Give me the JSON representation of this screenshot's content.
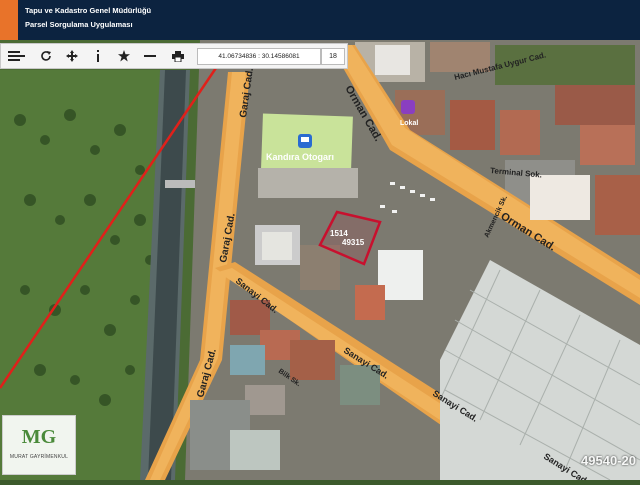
{
  "header": {
    "title_line1": "Tapu ve Kadastro Genel Müdürlüğü",
    "title_line2": "Parsel Sorgulama Uygulaması"
  },
  "toolbar": {
    "buttons": [
      {
        "icon": "menu-icon"
      },
      {
        "icon": "zoom-out-icon"
      },
      {
        "icon": "refresh-icon"
      },
      {
        "icon": "move-icon"
      },
      {
        "icon": "info-icon"
      },
      {
        "icon": "star-icon"
      },
      {
        "icon": "measure-icon"
      },
      {
        "icon": "print-icon"
      }
    ],
    "coordinates": "41.06734836 : 30.14586081",
    "zoom_level": "18"
  },
  "map": {
    "streets": {
      "orman_cad_north": "Orman Cad.",
      "orman_cad_east": "Orman Cad.",
      "garaj_cad_north": "Garaj Cad.",
      "garaj_cad_mid": "Garaj Cad.",
      "garaj_cad_south": "Garaj Cad.",
      "sanayi_cad_1": "Sanayi Cad.",
      "sanayi_cad_2": "Sanayi Cad.",
      "sanayi_cad_3": "Sanayi Cad.",
      "sanayi_cad_4": "Sanayi Cad.",
      "haci_mustafa": "Hacı Mustafa Uygur Cad.",
      "terminal_sok": "Terminal Sok.",
      "side_street": "Bilk Sk.",
      "side_street_2": "Akmencik Sk."
    },
    "poi": {
      "bus_station": "Kandıra Otogarı",
      "pharmacy": "Lokal"
    },
    "parcel": {
      "line1": "1514",
      "line2": "49315"
    }
  },
  "branding": {
    "logo_text": "MG",
    "logo_subtext": "MURAT GAYRİMENKUL",
    "watermark": "49540-20"
  },
  "colors": {
    "header_bg": "#0c2340",
    "accent": "#e8732a",
    "road_fill": "#e8a34a",
    "parcel_outline": "#c8102e",
    "boundary_line": "#e0201a"
  }
}
